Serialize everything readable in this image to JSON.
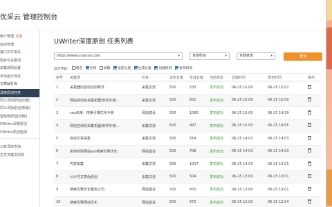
{
  "app": {
    "title": "优采云 管理控制台"
  },
  "sidebar": {
    "items": [
      {
        "label": "账户管理",
        "tag": "充值"
      },
      {
        "label": "站点管理"
      },
      {
        "label": "接口文件相关"
      },
      {
        "label": "短目与关键词"
      },
      {
        "label": "采集规则设置"
      },
      {
        "label": "手动运行测试"
      },
      {
        "label": "文章解析库"
      },
      {
        "label": "深度原创任务",
        "active": true
      },
      {
        "label": "同义词伪原创[旧版]"
      },
      {
        "label": "同义词伪原创[新版]"
      },
      {
        "label": "智能伪原创[旧版]"
      },
      {
        "label": "UWriter深度原创"
      },
      {
        "label": "UWriter原创检测"
      },
      {
        "label": "公有词库查询"
      },
      {
        "label": "正文关键词识别"
      }
    ]
  },
  "page": {
    "title": "UWriter深度原创 任务列表"
  },
  "filters": {
    "url_value": "https://www.ucaiyun.com",
    "column_value": "全部栏目",
    "status_value": "全部状态",
    "search_label": "查询"
  },
  "display_fields": {
    "label": "显示字段：",
    "options": [
      {
        "label": "域名",
        "checked": false
      },
      {
        "label": "栏目",
        "checked": true
      },
      {
        "label": "标题",
        "checked": false
      },
      {
        "label": "设定长度",
        "checked": true
      },
      {
        "label": "生成长度",
        "checked": true
      },
      {
        "label": "创建时间",
        "checked": true
      },
      {
        "label": "发布时间",
        "checked": true
      }
    ]
  },
  "table": {
    "columns": [
      "序号",
      "关键词",
      "栏目",
      "设定长度",
      "生成长度",
      "当前状态",
      "创建时间",
      "发布时间",
      "操作"
    ],
    "rows": [
      [
        "1",
        "采集器的自动识别算法",
        "采集交流",
        "500",
        "533",
        "发布成功",
        "06-25 15:00",
        "06-25 15:02"
      ],
      [
        "2",
        "网站自动化采集机器/软件外链...",
        "采集交流",
        "500",
        "601",
        "发布成功",
        "06-25 15:00",
        "06-25 15:00"
      ],
      [
        "3",
        "seo未来：搜索引擎优化手册",
        "网站建设",
        "500",
        "1060",
        "发布成功",
        "06-25 15:00",
        "06-25 14:59"
      ],
      [
        "4",
        "网站自动化采集机器/软件外链...",
        "采集交流",
        "500",
        "497",
        "发布成功",
        "06-25 15:00",
        "06-25 14:05"
      ],
      [
        "5",
        "自动文章采集",
        "采集交流",
        "500",
        "554",
        "发布成功",
        "06-25 14:03",
        "06-25 14:03"
      ],
      [
        "6",
        "房地商购网站seo搜索引擎优化",
        "网站建设",
        "500",
        "708",
        "发布成功",
        "06-25 14:03",
        "06-25 14:03"
      ],
      [
        "7",
        "内容采集",
        "采集交流",
        "500",
        "1017",
        "发布成功",
        "06-25 14:03",
        "06-25 13:01"
      ],
      [
        "8",
        "公众号文章伪原创",
        "采集交流",
        "500",
        "504",
        "发布成功",
        "06-25 13:00",
        "06-25 13:01"
      ],
      [
        "9",
        "搜索引擎优化服务公司",
        "网站建设",
        "500",
        "470",
        "发布成功",
        "06-25 13:00",
        "06-25 13:01"
      ],
      [
        "10",
        "搜索引擎网站优化",
        "网站建设",
        "500",
        "572",
        "发布成功",
        "06-25 12:03",
        "06-25 12:04"
      ]
    ]
  },
  "colors": {
    "accent": "#f0912a",
    "sidebar_active": "#2f4156",
    "success": "#2a9d2a",
    "checkbox": "#2b6cb0"
  }
}
